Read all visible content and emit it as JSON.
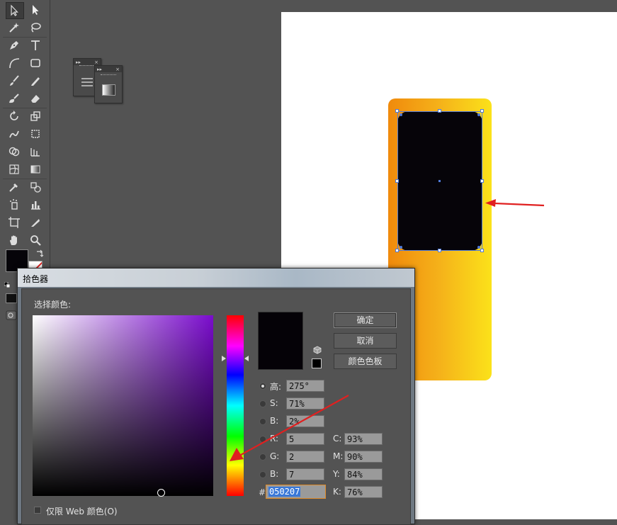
{
  "dialog": {
    "title": "拾色器",
    "select_color_label": "选择颜色:",
    "buttons": {
      "ok": "确定",
      "cancel": "取消",
      "swatches": "颜色色板"
    },
    "hsb": {
      "h_label": "高:",
      "h_value": "275°",
      "s_label": "S:",
      "s_value": "71%",
      "b_label": "B:",
      "b_value": "2%"
    },
    "rgb": {
      "r_label": "R:",
      "r_value": "5",
      "g_label": "G:",
      "g_value": "2",
      "b_label": "B:",
      "b_value": "7"
    },
    "cmyk": {
      "c_label": "C:",
      "c_value": "93%",
      "m_label": "M:",
      "m_value": "90%",
      "y_label": "Y:",
      "y_value": "84%",
      "k_label": "K:",
      "k_value": "76%"
    },
    "hex_label": "#",
    "hex_value": "050207",
    "websafe_label": "仅限 Web 颜色(O)"
  },
  "colors": {
    "current_color": "#050207",
    "gradient_start": "#f08a0c",
    "gradient_end": "#fbe21a",
    "annotation_arrow": "#e02020",
    "selection": "#4f7ad9"
  },
  "toolbar": {
    "icons": [
      "selection-tool-icon",
      "direct-selection-tool-icon",
      "magic-wand-icon",
      "lasso-icon",
      "pen-tool-icon",
      "type-tool-icon",
      "arc-tool-icon",
      "rectangle-tool-icon",
      "paintbrush-icon",
      "pencil-icon",
      "blob-brush-icon",
      "eraser-icon",
      "rotate-tool-icon",
      "scale-tool-icon",
      "warp-tool-icon",
      "free-transform-icon",
      "shape-builder-icon",
      "perspective-grid-icon",
      "mesh-tool-icon",
      "gradient-tool-icon",
      "eyedropper-icon",
      "blend-tool-icon",
      "symbol-sprayer-icon",
      "column-graph-icon",
      "artboard-tool-icon",
      "slice-tool-icon",
      "hand-tool-icon",
      "zoom-tool-icon"
    ]
  }
}
